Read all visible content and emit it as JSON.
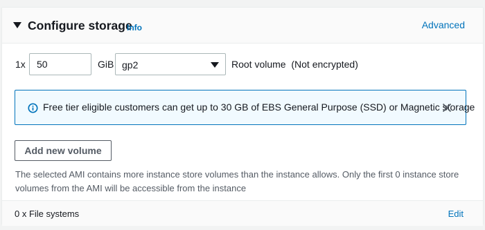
{
  "header": {
    "title": "Configure storage",
    "info_link": "Info",
    "advanced_link": "Advanced"
  },
  "volume": {
    "count_prefix": "1x",
    "size_value": "50",
    "unit": "GiB",
    "type_selected": "gp2",
    "description": "Root volume  (Not encrypted)"
  },
  "alert": {
    "type": "info",
    "icon": "info-circle-icon",
    "text": "Free tier eligible customers can get up to 30 GB of EBS General Purpose (SSD) or Magnetic storage",
    "close_icon": "close-icon",
    "accent_color": "#0073bb"
  },
  "actions": {
    "add_volume_label": "Add new volume"
  },
  "note": "The selected AMI contains more instance store volumes than the instance allows. Only the first 0 instance store volumes from the AMI will be accessible from the instance",
  "file_systems": {
    "label": "0 x File systems",
    "edit_link": "Edit"
  }
}
